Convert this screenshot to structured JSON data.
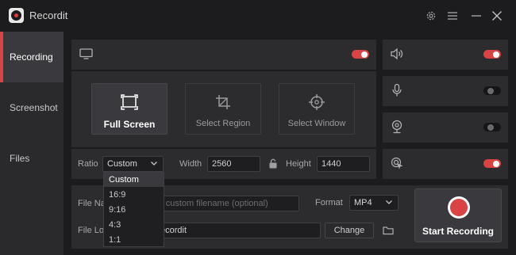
{
  "app": {
    "title": "Recordit"
  },
  "titlebar": {
    "icons": [
      "gear-icon",
      "menu-icon",
      "minimize-icon",
      "close-icon"
    ]
  },
  "sidebar": {
    "items": [
      {
        "label": "Recording",
        "active": true
      },
      {
        "label": "Screenshot",
        "active": false
      },
      {
        "label": "Files",
        "active": false
      }
    ]
  },
  "capture": {
    "display_toggle": true,
    "modes": [
      {
        "label": "Full Screen",
        "icon": "fullscreen-icon",
        "active": true
      },
      {
        "label": "Select Region",
        "icon": "crop-icon",
        "active": false
      },
      {
        "label": "Select Window",
        "icon": "target-icon",
        "active": false
      }
    ],
    "ratio_label": "Ratio",
    "ratio_value": "Custom",
    "ratio_options": [
      "Custom",
      "16:9",
      "9:16",
      "4:3",
      "1:1"
    ],
    "width_label": "Width",
    "width_value": "2560",
    "height_label": "Height",
    "height_value": "1440"
  },
  "audio": {
    "system_sound": true,
    "microphone": false,
    "webcam": false,
    "mouse_clicks": true
  },
  "output": {
    "file_name_label": "File Na",
    "file_name_placeholder": "r custom filename (optional)",
    "format_label": "Format",
    "format_value": "MP4",
    "file_location_label": "File Lo",
    "file_location_value": "ecordit",
    "change_label": "Change"
  },
  "start": {
    "label": "Start Recording"
  },
  "colors": {
    "accent": "#d94343",
    "background": "#1c1c1e",
    "panel": "#2c2c2f"
  }
}
